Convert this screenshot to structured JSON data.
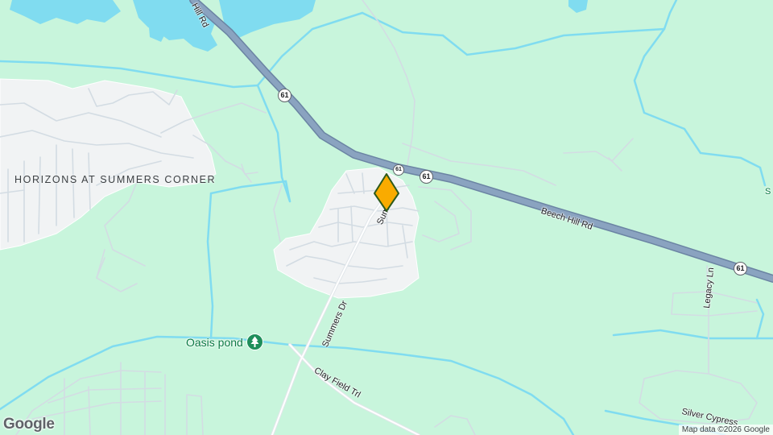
{
  "map": {
    "area_label": "HORIZONS AT SUMMERS CORNER",
    "roads": {
      "beech_hill": "Beech Hill Rd",
      "hill_rd_north": "Hill Rd",
      "summers_dr": "Summers Dr",
      "summers_partial": "Sum",
      "clay_field": "Clay Field Trl",
      "legacy": "Legacy Ln",
      "silver_cypress": "Silver Cypress"
    },
    "route_shields": [
      "61",
      "61",
      "61",
      "61"
    ],
    "poi": {
      "name": "Oasis pond",
      "icon": "park-tree-icon"
    },
    "edge_text": "S",
    "pin": {
      "icon": "location-pin-icon",
      "color": "#f9ab00",
      "stroke": "#2d5a1b"
    }
  },
  "footer": {
    "logo": "Google",
    "attribution": "Map data ©2026 Google"
  },
  "colors": {
    "land": "#c8f5dc",
    "water": "#80dcf0",
    "highway": "#8aa3c0",
    "residential": "#f1f3f4"
  }
}
